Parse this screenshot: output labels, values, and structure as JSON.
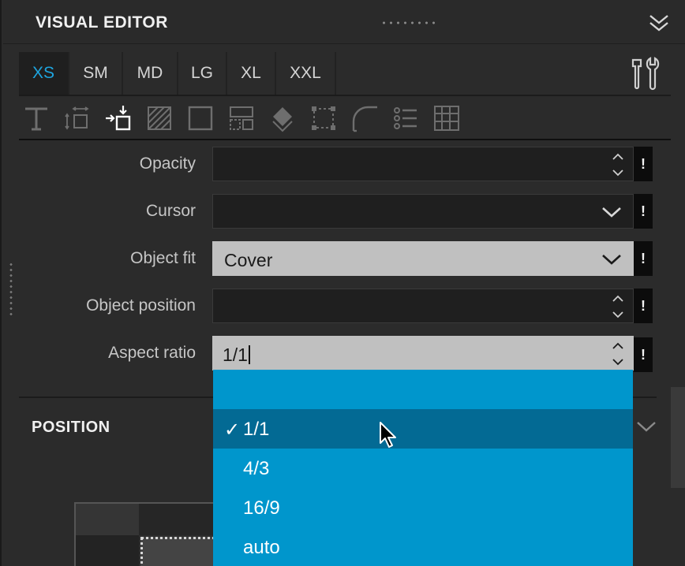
{
  "panel": {
    "title": "VISUAL EDITOR",
    "icons": {
      "drag": "drag-handle-icon",
      "collapse": "double-chevron-down-icon",
      "tools": "tools-icon"
    }
  },
  "tabs": [
    {
      "label": "XS",
      "active": true
    },
    {
      "label": "SM",
      "active": false
    },
    {
      "label": "MD",
      "active": false
    },
    {
      "label": "LG",
      "active": false
    },
    {
      "label": "XL",
      "active": false
    },
    {
      "label": "XXL",
      "active": false
    }
  ],
  "toolbar": [
    "text-icon",
    "spacing-icon",
    "layout-icon",
    "background-icon",
    "border-icon",
    "flex-icon",
    "transform-icon",
    "box-icon",
    "radius-icon",
    "list-icon",
    "grid-icon"
  ],
  "properties": [
    {
      "label": "Opacity",
      "value": "",
      "control": "spinner"
    },
    {
      "label": "Cursor",
      "value": "",
      "control": "select"
    },
    {
      "label": "Object fit",
      "value": "Cover",
      "control": "select"
    },
    {
      "label": "Object position",
      "value": "",
      "control": "spinner"
    },
    {
      "label": "Aspect ratio",
      "value": "1/1",
      "control": "spinner"
    }
  ],
  "important_label": "!",
  "section": {
    "title": "POSITION"
  },
  "dropdown": {
    "options": [
      "",
      "1/1",
      "4/3",
      "16/9",
      "auto"
    ],
    "selected": "1/1",
    "check": "✓"
  },
  "colors": {
    "accent": "#1ea5df",
    "dropdown_bg": "#0096cc",
    "dropdown_selected": "#036a94"
  }
}
